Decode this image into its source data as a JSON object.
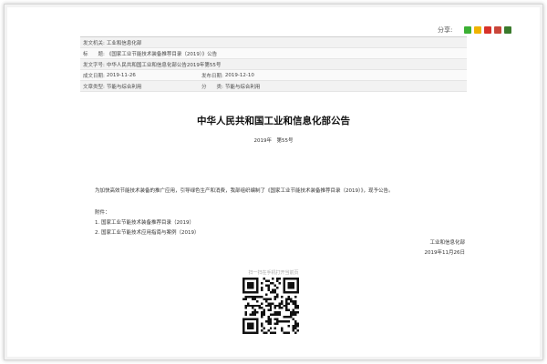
{
  "share": {
    "label": "分享:",
    "icons": [
      {
        "name": "wechat-share-icon",
        "color": "#3cb034"
      },
      {
        "name": "qzone-share-icon",
        "color": "#f0b300"
      },
      {
        "name": "weibo-share-icon",
        "color": "#d8322a"
      },
      {
        "name": "renren-share-icon",
        "color": "#c9463a"
      },
      {
        "name": "douban-share-icon",
        "color": "#3a7a2c"
      }
    ]
  },
  "meta": {
    "issuer_label": "发文机关:",
    "issuer_value": "工业和信息化部",
    "title_label": "标　　题:",
    "title_value": "《国家工业节能技术装备推荐目录（2019）》公告",
    "docno_label": "发文字号:",
    "docno_value": "中华人民共和国工业和信息化部公告2019年第55号",
    "date_label": "成文日期:",
    "date_value": "2019-11-26",
    "pub_label": "发布日期:",
    "pub_value": "2019-12-10",
    "category_label": "文章类型:",
    "category_value": "节能与综合利用",
    "topic_label": "分　　类:",
    "topic_value": "节能与综合利用"
  },
  "doc": {
    "title": "中华人民共和国工业和信息化部公告",
    "number": "2019年　第55号",
    "body": "为加快高效节能技术装备的推广应用，引导绿色生产和消费，我部组织编制了《国家工业节能技术装备推荐目录（2019）》，现予公告。",
    "attachments_label": "附件：",
    "attachments": [
      "1. 国家工业节能技术装备推荐目录（2019）",
      "2. 国家工业节能技术应用指南与案例（2019）"
    ],
    "signer": "工业和信息化部",
    "sign_date": "2019年11月26日"
  },
  "qr": {
    "caption": "扫一扫在手机打开当前页"
  }
}
